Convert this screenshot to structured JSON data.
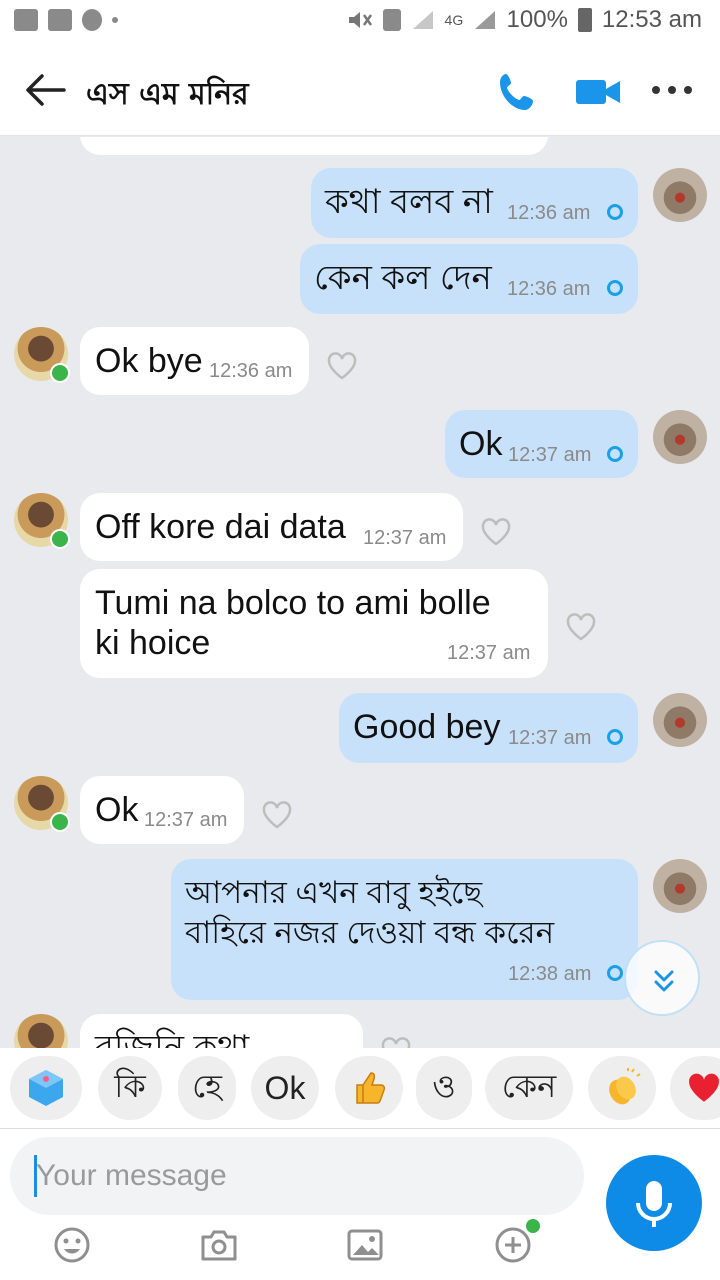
{
  "status_bar": {
    "battery": "100%",
    "time": "12:53 am",
    "network": "4G"
  },
  "header": {
    "title": "এস এম মনির"
  },
  "messages": [
    {
      "dir": "out",
      "text": "কথা বলব না",
      "time": "12:36 am"
    },
    {
      "dir": "out",
      "text": "কেন কল দেন",
      "time": "12:36 am"
    },
    {
      "dir": "in",
      "text": "Ok bye",
      "time": "12:36 am"
    },
    {
      "dir": "out",
      "text": "Ok",
      "time": "12:37 am"
    },
    {
      "dir": "in",
      "text": "Off kore dai data",
      "time": "12:37 am"
    },
    {
      "dir": "in",
      "text": "Tumi na bolco to ami bolle\nki hoice",
      "time": "12:37 am"
    },
    {
      "dir": "out",
      "text": "Good bey",
      "time": "12:37 am"
    },
    {
      "dir": "in",
      "text": "Ok",
      "time": "12:37 am"
    },
    {
      "dir": "out",
      "text": "আপনার এখন বাবু হইছে\nবাহিরে নজর দেওয়া বন্ধ করেন",
      "time": "12:38 am"
    },
    {
      "dir": "in",
      "text": "বুজিনি কথা",
      "time": ""
    }
  ],
  "quick_replies": [
    "কি",
    "হে",
    "Ok",
    "ও",
    "কেন"
  ],
  "quick_reply_emojis": [
    "dice-icon",
    "thumbs-up-icon",
    "clapping-hands-icon",
    "heart-icon"
  ],
  "input": {
    "placeholder": "Your message"
  },
  "toolbar": [
    "emoji-icon",
    "camera-icon",
    "gallery-icon",
    "add-icon"
  ],
  "colors": {
    "accent": "#0e8be6",
    "outgoing_bubble": "#c8e1fb",
    "incoming_bubble": "#ffffff",
    "background": "#e9eaee",
    "online": "#3bb54a"
  }
}
